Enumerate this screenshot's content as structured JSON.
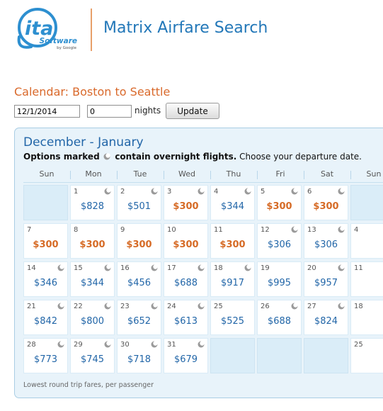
{
  "header": {
    "logo_mark": "ita",
    "logo_software": "Software",
    "logo_byline": "by Google",
    "app_title": "Matrix Airfare Search"
  },
  "search": {
    "heading": "Calendar: Boston to Seattle",
    "date_value": "12/1/2014",
    "nights_value": "0",
    "nights_label": "nights",
    "update_label": "Update"
  },
  "calendar": {
    "title": "December - January",
    "note_bold_1": "Options marked",
    "note_bold_2": "contain overnight flights.",
    "note_rest": " Choose your departure date.",
    "weekdays": [
      "Sun",
      "Mon",
      "Tue",
      "Wed",
      "Thu",
      "Fri",
      "Sat",
      "Sun"
    ],
    "footer": "Lowest round trip fares, per passenger",
    "weeks": [
      [
        {
          "empty": true
        },
        {
          "day": "1",
          "price": "$828",
          "cheap": false,
          "overnight": true
        },
        {
          "day": "2",
          "price": "$501",
          "cheap": false,
          "overnight": true
        },
        {
          "day": "3",
          "price": "$300",
          "cheap": true,
          "overnight": true
        },
        {
          "day": "4",
          "price": "$344",
          "cheap": false,
          "overnight": true
        },
        {
          "day": "5",
          "price": "$300",
          "cheap": true,
          "overnight": true
        },
        {
          "day": "6",
          "price": "$300",
          "cheap": true,
          "overnight": true
        },
        {
          "empty": true
        }
      ],
      [
        {
          "day": "7",
          "price": "$300",
          "cheap": true,
          "overnight": false
        },
        {
          "day": "8",
          "price": "$300",
          "cheap": true,
          "overnight": false
        },
        {
          "day": "9",
          "price": "$300",
          "cheap": true,
          "overnight": false
        },
        {
          "day": "10",
          "price": "$300",
          "cheap": true,
          "overnight": false
        },
        {
          "day": "11",
          "price": "$300",
          "cheap": true,
          "overnight": false
        },
        {
          "day": "12",
          "price": "$306",
          "cheap": false,
          "overnight": true
        },
        {
          "day": "13",
          "price": "$306",
          "cheap": false,
          "overnight": true
        },
        {
          "day": "4",
          "price": "",
          "cheap": false,
          "overnight": false
        }
      ],
      [
        {
          "day": "14",
          "price": "$346",
          "cheap": false,
          "overnight": true
        },
        {
          "day": "15",
          "price": "$344",
          "cheap": false,
          "overnight": true
        },
        {
          "day": "16",
          "price": "$456",
          "cheap": false,
          "overnight": true
        },
        {
          "day": "17",
          "price": "$688",
          "cheap": false,
          "overnight": true
        },
        {
          "day": "18",
          "price": "$917",
          "cheap": false,
          "overnight": true
        },
        {
          "day": "19",
          "price": "$995",
          "cheap": false,
          "overnight": false
        },
        {
          "day": "20",
          "price": "$957",
          "cheap": false,
          "overnight": true
        },
        {
          "day": "11",
          "price": "",
          "cheap": false,
          "overnight": false
        }
      ],
      [
        {
          "day": "21",
          "price": "$842",
          "cheap": false,
          "overnight": true
        },
        {
          "day": "22",
          "price": "$800",
          "cheap": false,
          "overnight": true
        },
        {
          "day": "23",
          "price": "$652",
          "cheap": false,
          "overnight": true
        },
        {
          "day": "24",
          "price": "$613",
          "cheap": false,
          "overnight": true
        },
        {
          "day": "25",
          "price": "$525",
          "cheap": false,
          "overnight": false
        },
        {
          "day": "26",
          "price": "$688",
          "cheap": false,
          "overnight": true
        },
        {
          "day": "27",
          "price": "$824",
          "cheap": false,
          "overnight": true
        },
        {
          "day": "18",
          "price": "",
          "cheap": false,
          "overnight": false
        }
      ],
      [
        {
          "day": "28",
          "price": "$773",
          "cheap": false,
          "overnight": true
        },
        {
          "day": "29",
          "price": "$745",
          "cheap": false,
          "overnight": true
        },
        {
          "day": "30",
          "price": "$718",
          "cheap": false,
          "overnight": true
        },
        {
          "day": "31",
          "price": "$679",
          "cheap": false,
          "overnight": true
        },
        {
          "empty": true
        },
        {
          "empty": true
        },
        {
          "empty": true
        },
        {
          "day": "25",
          "price": "",
          "cheap": false,
          "overnight": false
        }
      ]
    ]
  },
  "colors": {
    "accent_blue": "#2266a8",
    "cheap_orange": "#d66b26",
    "heading_orange": "#d9692b",
    "panel_bg": "#e8f3fa"
  }
}
